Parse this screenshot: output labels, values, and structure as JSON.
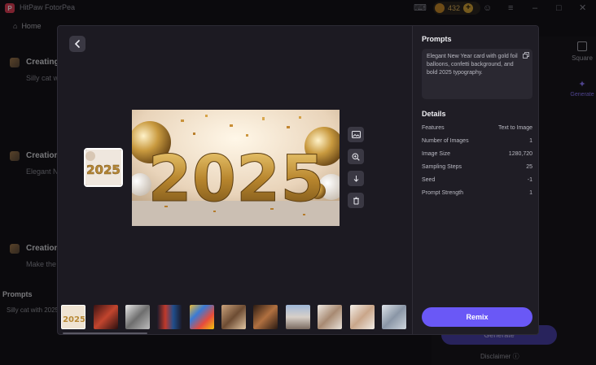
{
  "app": {
    "title": "HitPaw FotorPea",
    "logo_letter": "P",
    "coins": "432",
    "home_label": "Home"
  },
  "background": {
    "items": [
      {
        "title": "Creating",
        "sub": "Silly cat w"
      },
      {
        "title": "Creation",
        "sub": "Elegant N"
      },
      {
        "title": "Creation",
        "sub": "Make the"
      }
    ],
    "left_prompts_heading": "Prompts",
    "left_prompts_text": "Silly cat with 2025",
    "right_square_label": "Square",
    "right_generate_tab": "Generate",
    "generate_button": "Generate",
    "disclaimer": "Disclaimer"
  },
  "modal": {
    "back_icon": "chevron-left-icon",
    "side_tools": [
      "image-icon",
      "zoom-in-icon",
      "download-icon",
      "trash-icon"
    ],
    "prompts_heading": "Prompts",
    "prompt_text": "Elegant New Year card with gold foil balloons, confetti background, and bold 2025 typography.",
    "details_heading": "Details",
    "details": [
      {
        "key": "Features",
        "value": "Text to Image"
      },
      {
        "key": "Number of Images",
        "value": "1"
      },
      {
        "key": "Image Size",
        "value": "1280,720"
      },
      {
        "key": "Sampling Steps",
        "value": "25"
      },
      {
        "key": "Seed",
        "value": "-1"
      },
      {
        "key": "Prompt Strength",
        "value": "1"
      }
    ],
    "remix_label": "Remix",
    "main_image_text": "2025",
    "thumbnail_text": "2025",
    "strip_count": 11,
    "active_thumb_index": 0
  },
  "colors": {
    "accent": "#6a58f6",
    "gold": "#d4a24a",
    "background": "#1c1a22"
  }
}
